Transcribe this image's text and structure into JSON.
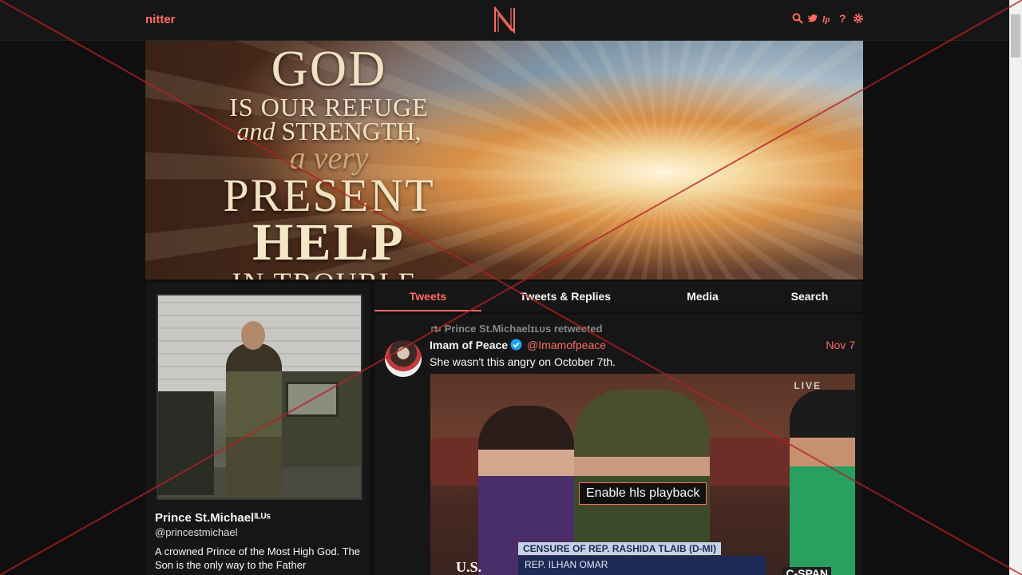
{
  "navbar": {
    "brand": "nitter",
    "logo_letter": "N",
    "icons": [
      "search-icon",
      "twitter-bird-icon",
      "lp-icon",
      "question-icon",
      "gear-icon"
    ]
  },
  "banner": {
    "line1": "GOD",
    "line2": "IS OUR REFUGE",
    "line3_italic": "and",
    "line3": "STRENGTH,",
    "line4": "a very",
    "line5": "PRESENT",
    "line6": "HELP",
    "line7": "IN TROUBLE."
  },
  "profile": {
    "name": "Prince St.Michaelᴵᴸᵁˢ",
    "handle": "@princestmichael",
    "bio": "A crowned Prince of the Most High God. The Son is the only way to the Father"
  },
  "tabs": [
    {
      "label": "Tweets",
      "active": true
    },
    {
      "label": "Tweets & Replies",
      "active": false
    },
    {
      "label": "Media",
      "active": false
    },
    {
      "label": "Search",
      "active": false
    }
  ],
  "tweet": {
    "retweet_header": "Prince St.Michaelɪʟᴜs retweeted",
    "name": "Imam of Peace",
    "handle": "@Imamofpeace",
    "date": "Nov 7",
    "text": "She wasn't this angry on October 7th.",
    "media": {
      "live_label": "LIVE",
      "hls_button": "Enable hls playback",
      "chyron_title": "CENSURE OF REP. RASHIDA TLAIB (D-MI)",
      "chyron_name": "REP. ILHAN OMAR",
      "us_text": "U.S.",
      "network": "C-SPAN"
    }
  },
  "colors": {
    "accent": "#ff6c60",
    "background": "#0f0f0f",
    "panel": "#161616",
    "text": "#f8f8f2"
  }
}
